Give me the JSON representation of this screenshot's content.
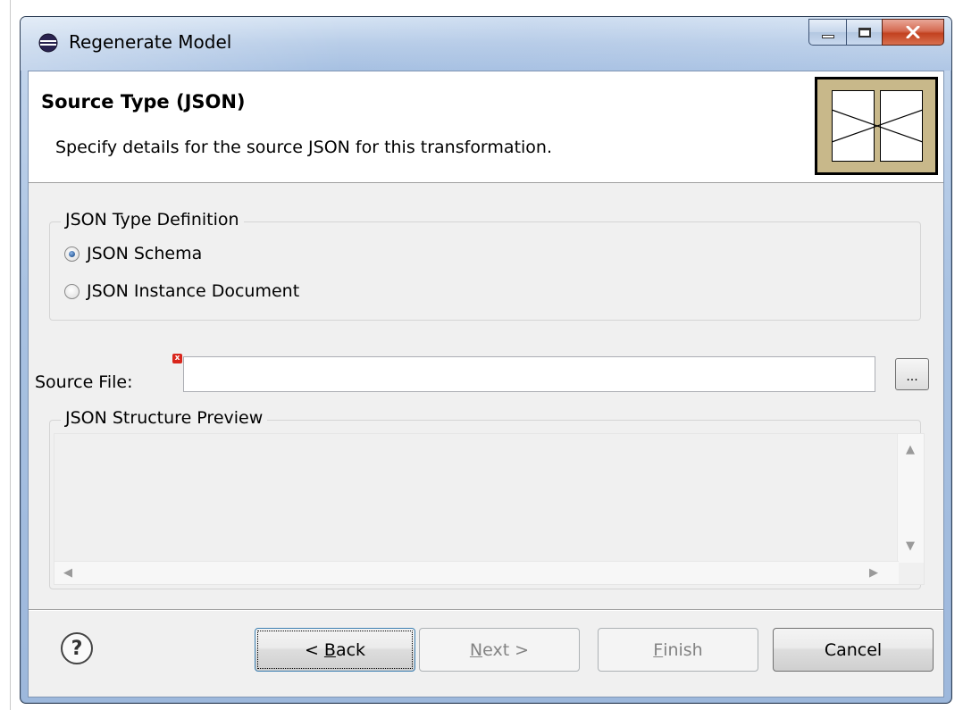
{
  "window": {
    "title": "Regenerate Model"
  },
  "header": {
    "title": "Source Type (JSON)",
    "description": "Specify details for the source JSON for this transformation."
  },
  "type_definition": {
    "legend": "JSON Type Definition",
    "options": [
      {
        "label": "JSON Schema",
        "selected": true
      },
      {
        "label": "JSON Instance Document",
        "selected": false
      }
    ]
  },
  "source_file": {
    "label": "Source File:",
    "value": "",
    "browse_label": "..."
  },
  "preview": {
    "legend": "JSON Structure Preview"
  },
  "buttons": {
    "back": {
      "prefix": "< ",
      "mnemonic": "B",
      "rest": "ack"
    },
    "next": {
      "mnemonic": "N",
      "rest": "ext >"
    },
    "finish": {
      "mnemonic": "F",
      "rest": "inish"
    },
    "cancel": "Cancel",
    "help": "?"
  },
  "colors": {
    "titlebar": "#b8cde8",
    "close_button": "#c2411f",
    "dialog_bg": "#f0f0f0",
    "header_image_bg": "#c8b88a"
  }
}
